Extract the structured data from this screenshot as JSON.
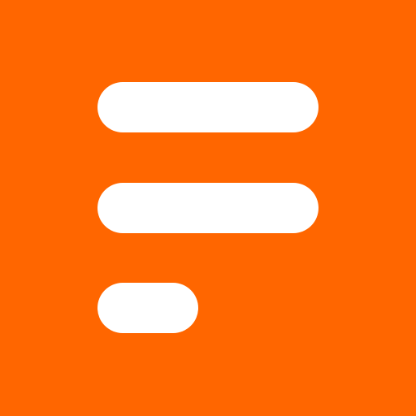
{
  "app_icon": {
    "icon": "text-lines-icon",
    "background_color": "#FF6600",
    "foreground_color": "#FFFFFF",
    "lines": [
      {
        "name": "line-long-1"
      },
      {
        "name": "line-long-2"
      },
      {
        "name": "line-short"
      }
    ]
  }
}
